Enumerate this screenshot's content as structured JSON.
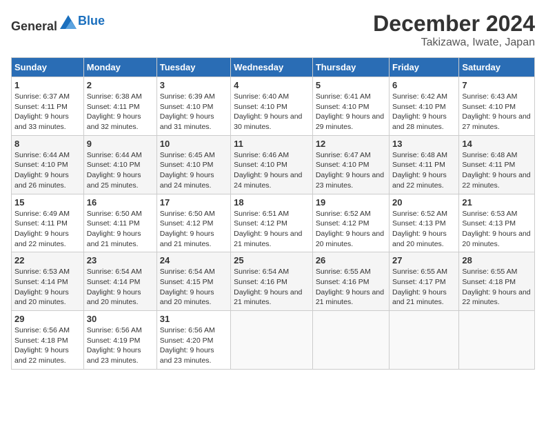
{
  "header": {
    "logo_line1": "General",
    "logo_line2": "Blue",
    "month": "December 2024",
    "location": "Takizawa, Iwate, Japan"
  },
  "weekdays": [
    "Sunday",
    "Monday",
    "Tuesday",
    "Wednesday",
    "Thursday",
    "Friday",
    "Saturday"
  ],
  "weeks": [
    [
      {
        "day": "1",
        "sunrise": "Sunrise: 6:37 AM",
        "sunset": "Sunset: 4:11 PM",
        "daylight": "Daylight: 9 hours and 33 minutes."
      },
      {
        "day": "2",
        "sunrise": "Sunrise: 6:38 AM",
        "sunset": "Sunset: 4:11 PM",
        "daylight": "Daylight: 9 hours and 32 minutes."
      },
      {
        "day": "3",
        "sunrise": "Sunrise: 6:39 AM",
        "sunset": "Sunset: 4:10 PM",
        "daylight": "Daylight: 9 hours and 31 minutes."
      },
      {
        "day": "4",
        "sunrise": "Sunrise: 6:40 AM",
        "sunset": "Sunset: 4:10 PM",
        "daylight": "Daylight: 9 hours and 30 minutes."
      },
      {
        "day": "5",
        "sunrise": "Sunrise: 6:41 AM",
        "sunset": "Sunset: 4:10 PM",
        "daylight": "Daylight: 9 hours and 29 minutes."
      },
      {
        "day": "6",
        "sunrise": "Sunrise: 6:42 AM",
        "sunset": "Sunset: 4:10 PM",
        "daylight": "Daylight: 9 hours and 28 minutes."
      },
      {
        "day": "7",
        "sunrise": "Sunrise: 6:43 AM",
        "sunset": "Sunset: 4:10 PM",
        "daylight": "Daylight: 9 hours and 27 minutes."
      }
    ],
    [
      {
        "day": "8",
        "sunrise": "Sunrise: 6:44 AM",
        "sunset": "Sunset: 4:10 PM",
        "daylight": "Daylight: 9 hours and 26 minutes."
      },
      {
        "day": "9",
        "sunrise": "Sunrise: 6:44 AM",
        "sunset": "Sunset: 4:10 PM",
        "daylight": "Daylight: 9 hours and 25 minutes."
      },
      {
        "day": "10",
        "sunrise": "Sunrise: 6:45 AM",
        "sunset": "Sunset: 4:10 PM",
        "daylight": "Daylight: 9 hours and 24 minutes."
      },
      {
        "day": "11",
        "sunrise": "Sunrise: 6:46 AM",
        "sunset": "Sunset: 4:10 PM",
        "daylight": "Daylight: 9 hours and 24 minutes."
      },
      {
        "day": "12",
        "sunrise": "Sunrise: 6:47 AM",
        "sunset": "Sunset: 4:10 PM",
        "daylight": "Daylight: 9 hours and 23 minutes."
      },
      {
        "day": "13",
        "sunrise": "Sunrise: 6:48 AM",
        "sunset": "Sunset: 4:11 PM",
        "daylight": "Daylight: 9 hours and 22 minutes."
      },
      {
        "day": "14",
        "sunrise": "Sunrise: 6:48 AM",
        "sunset": "Sunset: 4:11 PM",
        "daylight": "Daylight: 9 hours and 22 minutes."
      }
    ],
    [
      {
        "day": "15",
        "sunrise": "Sunrise: 6:49 AM",
        "sunset": "Sunset: 4:11 PM",
        "daylight": "Daylight: 9 hours and 22 minutes."
      },
      {
        "day": "16",
        "sunrise": "Sunrise: 6:50 AM",
        "sunset": "Sunset: 4:11 PM",
        "daylight": "Daylight: 9 hours and 21 minutes."
      },
      {
        "day": "17",
        "sunrise": "Sunrise: 6:50 AM",
        "sunset": "Sunset: 4:12 PM",
        "daylight": "Daylight: 9 hours and 21 minutes."
      },
      {
        "day": "18",
        "sunrise": "Sunrise: 6:51 AM",
        "sunset": "Sunset: 4:12 PM",
        "daylight": "Daylight: 9 hours and 21 minutes."
      },
      {
        "day": "19",
        "sunrise": "Sunrise: 6:52 AM",
        "sunset": "Sunset: 4:12 PM",
        "daylight": "Daylight: 9 hours and 20 minutes."
      },
      {
        "day": "20",
        "sunrise": "Sunrise: 6:52 AM",
        "sunset": "Sunset: 4:13 PM",
        "daylight": "Daylight: 9 hours and 20 minutes."
      },
      {
        "day": "21",
        "sunrise": "Sunrise: 6:53 AM",
        "sunset": "Sunset: 4:13 PM",
        "daylight": "Daylight: 9 hours and 20 minutes."
      }
    ],
    [
      {
        "day": "22",
        "sunrise": "Sunrise: 6:53 AM",
        "sunset": "Sunset: 4:14 PM",
        "daylight": "Daylight: 9 hours and 20 minutes."
      },
      {
        "day": "23",
        "sunrise": "Sunrise: 6:54 AM",
        "sunset": "Sunset: 4:14 PM",
        "daylight": "Daylight: 9 hours and 20 minutes."
      },
      {
        "day": "24",
        "sunrise": "Sunrise: 6:54 AM",
        "sunset": "Sunset: 4:15 PM",
        "daylight": "Daylight: 9 hours and 20 minutes."
      },
      {
        "day": "25",
        "sunrise": "Sunrise: 6:54 AM",
        "sunset": "Sunset: 4:16 PM",
        "daylight": "Daylight: 9 hours and 21 minutes."
      },
      {
        "day": "26",
        "sunrise": "Sunrise: 6:55 AM",
        "sunset": "Sunset: 4:16 PM",
        "daylight": "Daylight: 9 hours and 21 minutes."
      },
      {
        "day": "27",
        "sunrise": "Sunrise: 6:55 AM",
        "sunset": "Sunset: 4:17 PM",
        "daylight": "Daylight: 9 hours and 21 minutes."
      },
      {
        "day": "28",
        "sunrise": "Sunrise: 6:55 AM",
        "sunset": "Sunset: 4:18 PM",
        "daylight": "Daylight: 9 hours and 22 minutes."
      }
    ],
    [
      {
        "day": "29",
        "sunrise": "Sunrise: 6:56 AM",
        "sunset": "Sunset: 4:18 PM",
        "daylight": "Daylight: 9 hours and 22 minutes."
      },
      {
        "day": "30",
        "sunrise": "Sunrise: 6:56 AM",
        "sunset": "Sunset: 4:19 PM",
        "daylight": "Daylight: 9 hours and 23 minutes."
      },
      {
        "day": "31",
        "sunrise": "Sunrise: 6:56 AM",
        "sunset": "Sunset: 4:20 PM",
        "daylight": "Daylight: 9 hours and 23 minutes."
      },
      null,
      null,
      null,
      null
    ]
  ]
}
